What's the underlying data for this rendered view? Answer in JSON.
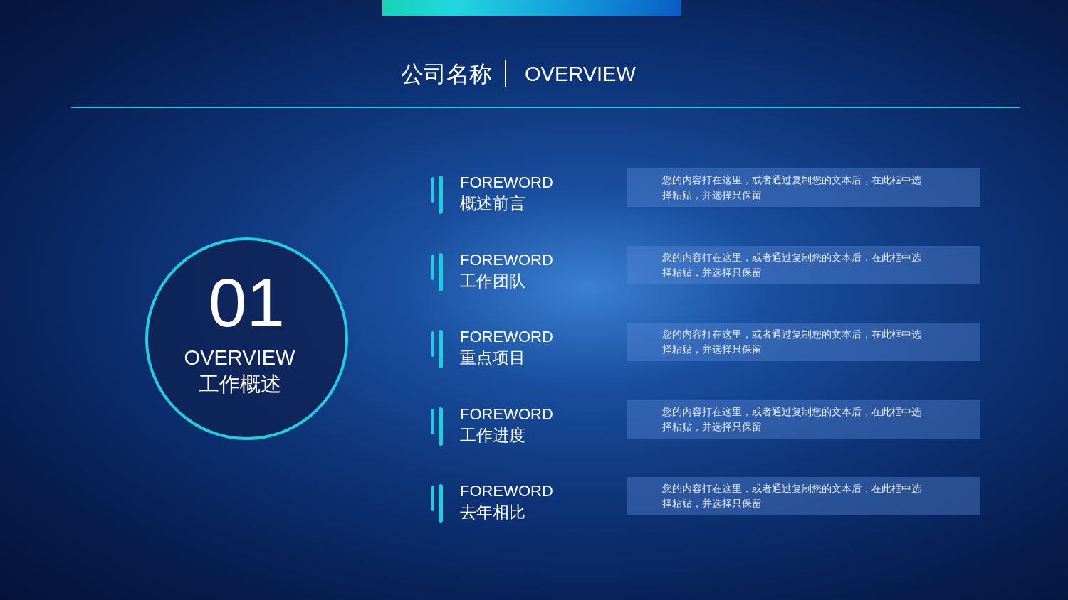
{
  "header": {
    "company_name": "公司名称",
    "title": "OVERVIEW"
  },
  "section": {
    "number": "01",
    "title": "OVERVIEW",
    "subtitle": "工作概述"
  },
  "items": [
    {
      "title": "FOREWORD",
      "subtitle": "概述前言",
      "description": "您的内容打在这里，或者通过复制您的文本后，在此框中选择粘贴，并选择只保留"
    },
    {
      "title": "FOREWORD",
      "subtitle": "工作团队",
      "description": "您的内容打在这里，或者通过复制您的文本后，在此框中选择粘贴，并选择只保留"
    },
    {
      "title": "FOREWORD",
      "subtitle": "重点项目",
      "description": "您的内容打在这里，或者通过复制您的文本后，在此框中选择粘贴，并选择只保留"
    },
    {
      "title": "FOREWORD",
      "subtitle": "工作进度",
      "description": "您的内容打在这里，或者通过复制您的文本后，在此框中选择粘贴，并选择只保留"
    },
    {
      "title": "FOREWORD",
      "subtitle": "去年相比",
      "description": "您的内容打在这里，或者通过复制您的文本后，在此框中选择粘贴，并选择只保留"
    }
  ]
}
